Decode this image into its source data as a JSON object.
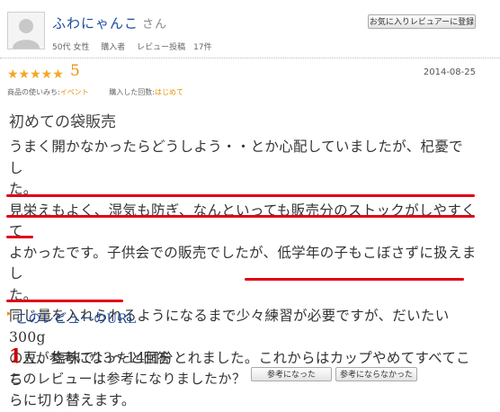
{
  "reviewer": {
    "name": "ふわにゃんこ",
    "honorific": "さん",
    "age_gender": "50代 女性",
    "purchaser": "購入者",
    "review_count": "レビュー投稿　17件",
    "favorite_button": "お気に入りレビュアーに登録"
  },
  "rating": {
    "stars": "★★★★★",
    "score": "5",
    "date": "2014-08-25"
  },
  "usage": {
    "purpose_label": "商品の使いみち:",
    "purpose_value": "イベント",
    "frequency_label": "購入した回数:",
    "frequency_value": "はじめて"
  },
  "review": {
    "title": "初めての袋販売",
    "lines": [
      "うまく開かなかったらどうしよう・・とか心配していましたが、杞憂でし",
      "た。",
      "見栄えもよく、湿気も防ぎ、なんといっても販売分のストックがしやすくて",
      "よかったです。子供会での販売でしたが、低学年の子もこぼさずに扱えまし",
      "た。",
      "同じ量を入れられるようになるまで少々練習が必要ですが、だいたい300g",
      "の豆、塩味で13～14個分とれました。これからはカップやめてすべてこち",
      "らに切り替えます。"
    ]
  },
  "link": {
    "label": "このレビューのURL"
  },
  "helpful": {
    "count": "1",
    "suffix": "人が参考になったと回答",
    "question": "このレビューは参考になりましたか？",
    "yes_button": "参考になった",
    "no_button": "参考にならなかった"
  },
  "colors": {
    "link": "#1a4ea3",
    "star": "#f5a623",
    "accent": "#e8900a",
    "highlight": "#e00017"
  }
}
